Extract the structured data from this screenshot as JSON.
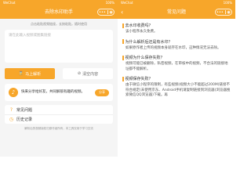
{
  "status": {
    "carrier": "WeChat",
    "time": "",
    "battery": "100%"
  },
  "left": {
    "nav_title": "去除水印助手",
    "tip": "点击粘贴视频链接，长按粘贴，随时使用",
    "input_placeholder": "请在此输入视频或图集链接",
    "parse_label": "马上解析",
    "clear_label": "清空内容",
    "notice_text": "快来分享给好友，共同解锁有趣的视频。",
    "share_label": "分享",
    "menu": [
      {
        "icon": "question-icon",
        "label": "常见问题"
      },
      {
        "icon": "history-icon",
        "label": "历史记录"
      }
    ],
    "footnote": "解析后的视频版权归原作者所有，本工具仅用于学习交流"
  },
  "right": {
    "nav_title": "常见问题",
    "faq": [
      {
        "q": "去水印收费吗？",
        "a": "该小程序永久免费。"
      },
      {
        "q": "为什么解析后还是有水印？",
        "a": "如果原作者上传的视频本身就存在水印，这种情况无法去除。"
      },
      {
        "q": "视频为什么保存失败？",
        "a": "视频可能已被删除，私密视频，在审核中的视频，不合法的链接地址都不能解析。"
      },
      {
        "q": "视频保存失败？",
        "a": "由于微信小程序的限制，有些视频(视频大小不能超过200M)链接不符合规定(未使用京东、Android手机请复制链接到浏览器(浏览器搜索微信QQ浏览器)下载。再"
      }
    ]
  }
}
